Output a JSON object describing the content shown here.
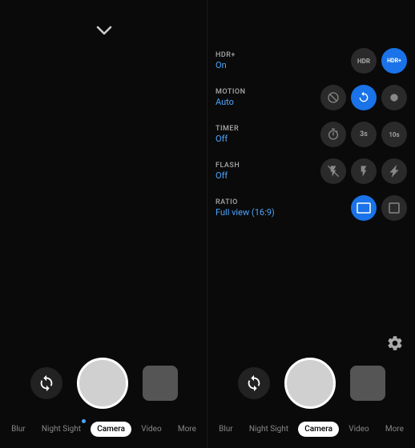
{
  "left": {
    "chevron": "⌄",
    "controls": {
      "flip_icon": "↺",
      "shutter": "",
      "preview": ""
    },
    "nav": [
      {
        "label": "Blur",
        "active": false,
        "dot": false
      },
      {
        "label": "Night Sight",
        "active": false,
        "dot": true
      },
      {
        "label": "Camera",
        "active": true,
        "dot": false
      },
      {
        "label": "Video",
        "active": false,
        "dot": false
      },
      {
        "label": "More",
        "active": false,
        "dot": false
      }
    ]
  },
  "right": {
    "settings": [
      {
        "id": "hdr",
        "title": "HDR+",
        "value": "On",
        "icons": [
          {
            "id": "hdr-off",
            "active": false,
            "symbol": "HDR"
          },
          {
            "id": "hdr-on",
            "active": true,
            "symbol": "HDR+"
          }
        ]
      },
      {
        "id": "motion",
        "title": "MOTION",
        "value": "Auto",
        "icons": [
          {
            "id": "motion-off",
            "active": false,
            "symbol": "🚫"
          },
          {
            "id": "motion-auto",
            "active": true,
            "symbol": "⟳"
          },
          {
            "id": "motion-on",
            "active": false,
            "symbol": "●"
          }
        ]
      },
      {
        "id": "timer",
        "title": "TIMER",
        "value": "Off",
        "icons": [
          {
            "id": "timer-off",
            "active": false,
            "symbol": "⏱"
          },
          {
            "id": "timer-3s",
            "active": false,
            "symbol": "3s"
          },
          {
            "id": "timer-10s",
            "active": false,
            "symbol": "10s"
          }
        ]
      },
      {
        "id": "flash",
        "title": "FLASH",
        "value": "Off",
        "icons": [
          {
            "id": "flash-off",
            "active": false,
            "symbol": "✕"
          },
          {
            "id": "flash-auto",
            "active": false,
            "symbol": "⚡"
          },
          {
            "id": "flash-on",
            "active": false,
            "symbol": "⚡"
          }
        ]
      },
      {
        "id": "ratio",
        "title": "RATIO",
        "value": "Full view (16:9)",
        "icons": [
          {
            "id": "ratio-full",
            "active": true,
            "symbol": "▬"
          },
          {
            "id": "ratio-square",
            "active": false,
            "symbol": "▪"
          }
        ]
      }
    ],
    "gear": "⚙",
    "nav": [
      {
        "label": "Blur",
        "active": false,
        "dot": false
      },
      {
        "label": "Night Sight",
        "active": false,
        "dot": false
      },
      {
        "label": "Camera",
        "active": true,
        "dot": false
      },
      {
        "label": "Video",
        "active": false,
        "dot": false
      },
      {
        "label": "More",
        "active": false,
        "dot": false
      }
    ]
  }
}
